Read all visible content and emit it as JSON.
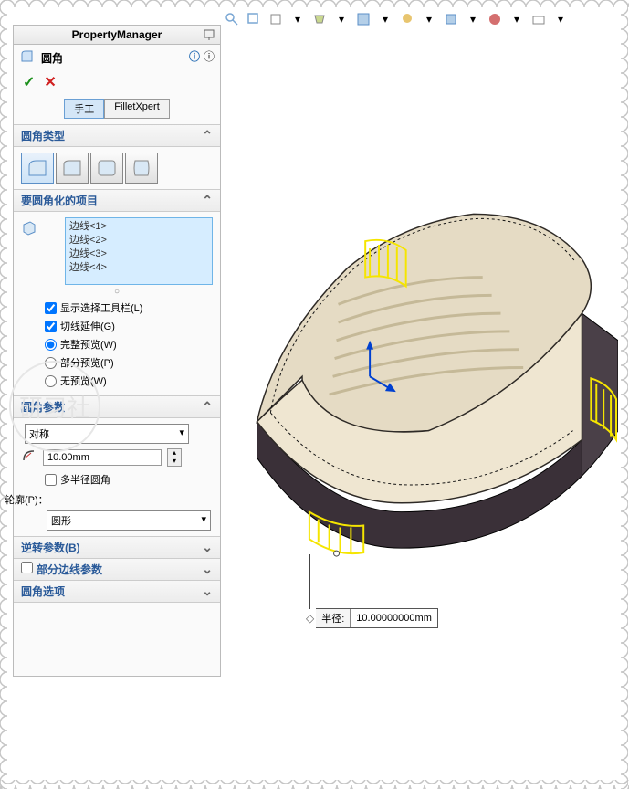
{
  "panel_title": "PropertyManager",
  "feature_name": "圆角",
  "ok_icon": "✓",
  "cancel_icon": "✕",
  "mode_tabs": {
    "manual": "手工",
    "xpert": "FilletXpert"
  },
  "sections": {
    "type": {
      "title": "圆角类型"
    },
    "items": {
      "title": "要圆角化的项目",
      "edges": [
        "边线<1>",
        "边线<2>",
        "边线<3>",
        "边线<4>"
      ],
      "show_toolbar": "显示选择工具栏(L)",
      "tangent": "切线延伸(G)",
      "full_preview": "完整预览(W)",
      "partial_preview": "部分预览(P)",
      "no_preview": "无预览(W)"
    },
    "params": {
      "title": "圆角参数",
      "symmetry": "对称",
      "radius": "10.00mm",
      "multi_radius": "多半径圆角",
      "profile_label": "轮廓(P)：",
      "profile": "圆形"
    },
    "reverse": {
      "title": "逆转参数(B)"
    },
    "partial_edge": {
      "title": "部分边线参数"
    },
    "options": {
      "title": "圆角选项"
    }
  },
  "callout": {
    "label": "半径:",
    "value": "10.00000000mm"
  },
  "watermark": "研习社"
}
